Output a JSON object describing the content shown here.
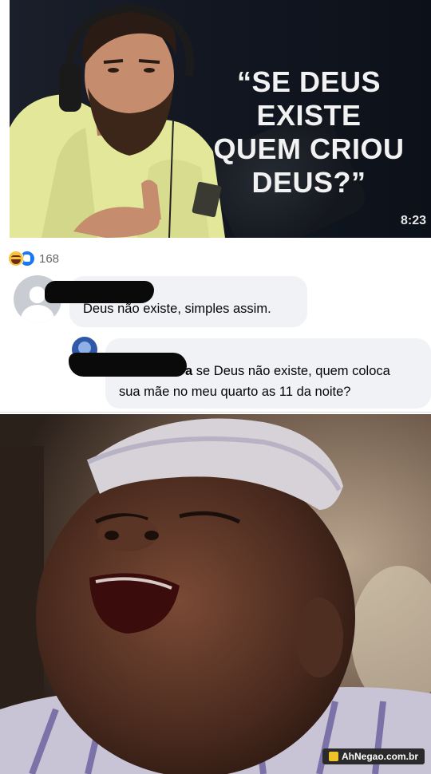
{
  "video": {
    "title_lines": [
      "“SE DEUS EXISTE",
      "QUEM CRIOU",
      "DEUS?”"
    ],
    "duration": "8:23"
  },
  "reactions": {
    "count": "168"
  },
  "comments": [
    {
      "text": "Deus não existe, simples assim."
    },
    {
      "reply_prefix": "a",
      "text": " se Deus não existe, quem coloca",
      "text_line2": "sua mãe no meu quarto as 11 da noite?"
    }
  ],
  "watermark": {
    "label": "AhNegao.com.br"
  },
  "colors": {
    "bubble": "#f0f2f5",
    "like_blue": "#1877f2",
    "haha_yellow": "#f7c33e",
    "hoodie_yellow": "#e7ea9c",
    "text": "#050505",
    "muted": "#65676b"
  }
}
